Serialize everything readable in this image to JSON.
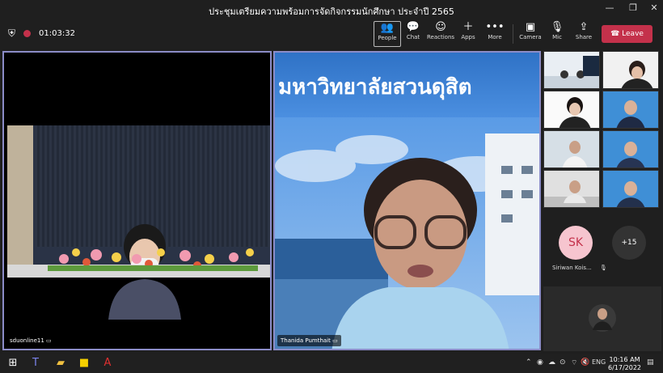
{
  "window": {
    "title": "ประชุมเตรียมความพร้อมการจัดกิจกรรมนักศึกษา ประจำปี 2565"
  },
  "toolbar": {
    "timer": "01:03:32",
    "people": "People",
    "chat": "Chat",
    "reactions": "Reactions",
    "apps": "Apps",
    "more": "More",
    "camera": "Camera",
    "mic": "Mic",
    "share": "Share",
    "leave": "Leave"
  },
  "tiles": {
    "main1_name": "sduonline11",
    "main2_name": "Thanida Pumthait",
    "banner_text": "มหาวิทยาลัยสวนดุสิต"
  },
  "side": {
    "initials": "SK",
    "more_count": "+15",
    "participant_name": "Siriwan Kois..."
  },
  "taskbar": {
    "language": "ENG",
    "time": "10:16 AM",
    "date": "6/17/2022"
  },
  "colors": {
    "leave": "#c4314b",
    "tile_border": "#8b8cc7",
    "avatar_bg": "#f6c5cf"
  }
}
